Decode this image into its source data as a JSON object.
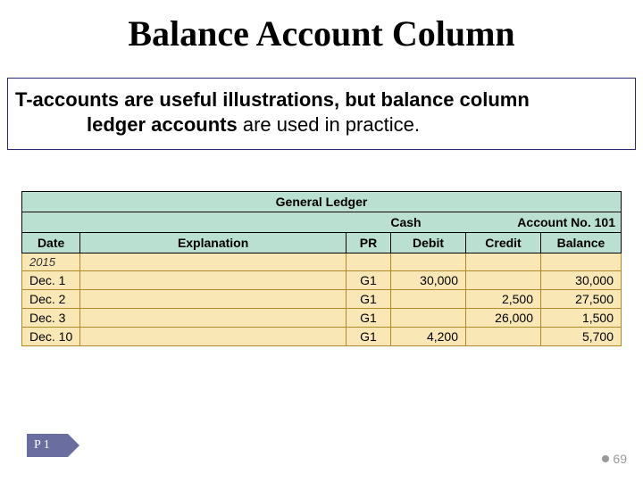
{
  "title": "Balance Account Column",
  "callout": {
    "prefix": "T-accounts are useful illustrations, but ",
    "bold1": "balance column",
    "bold2": "ledger accounts ",
    "suffix": "are used in practice."
  },
  "ledger": {
    "header_title": "General Ledger",
    "account_name": "Cash",
    "account_no_label": "Account No. 101",
    "columns": {
      "date": "Date",
      "explanation": "Explanation",
      "pr": "PR",
      "debit": "Debit",
      "credit": "Credit",
      "balance": "Balance"
    },
    "year": "2015",
    "rows": [
      {
        "date": "Dec.  1",
        "explanation": "",
        "pr": "G1",
        "debit": "30,000",
        "credit": "",
        "balance": "30,000"
      },
      {
        "date": "Dec.  2",
        "explanation": "",
        "pr": "G1",
        "debit": "",
        "credit": "2,500",
        "balance": "27,500"
      },
      {
        "date": "Dec.  3",
        "explanation": "",
        "pr": "G1",
        "debit": "",
        "credit": "26,000",
        "balance": "1,500"
      },
      {
        "date": "Dec. 10",
        "explanation": "",
        "pr": "G1",
        "debit": "4,200",
        "credit": "",
        "balance": "5,700"
      }
    ]
  },
  "footer": {
    "tag": "P 1",
    "slide_number": "69"
  }
}
